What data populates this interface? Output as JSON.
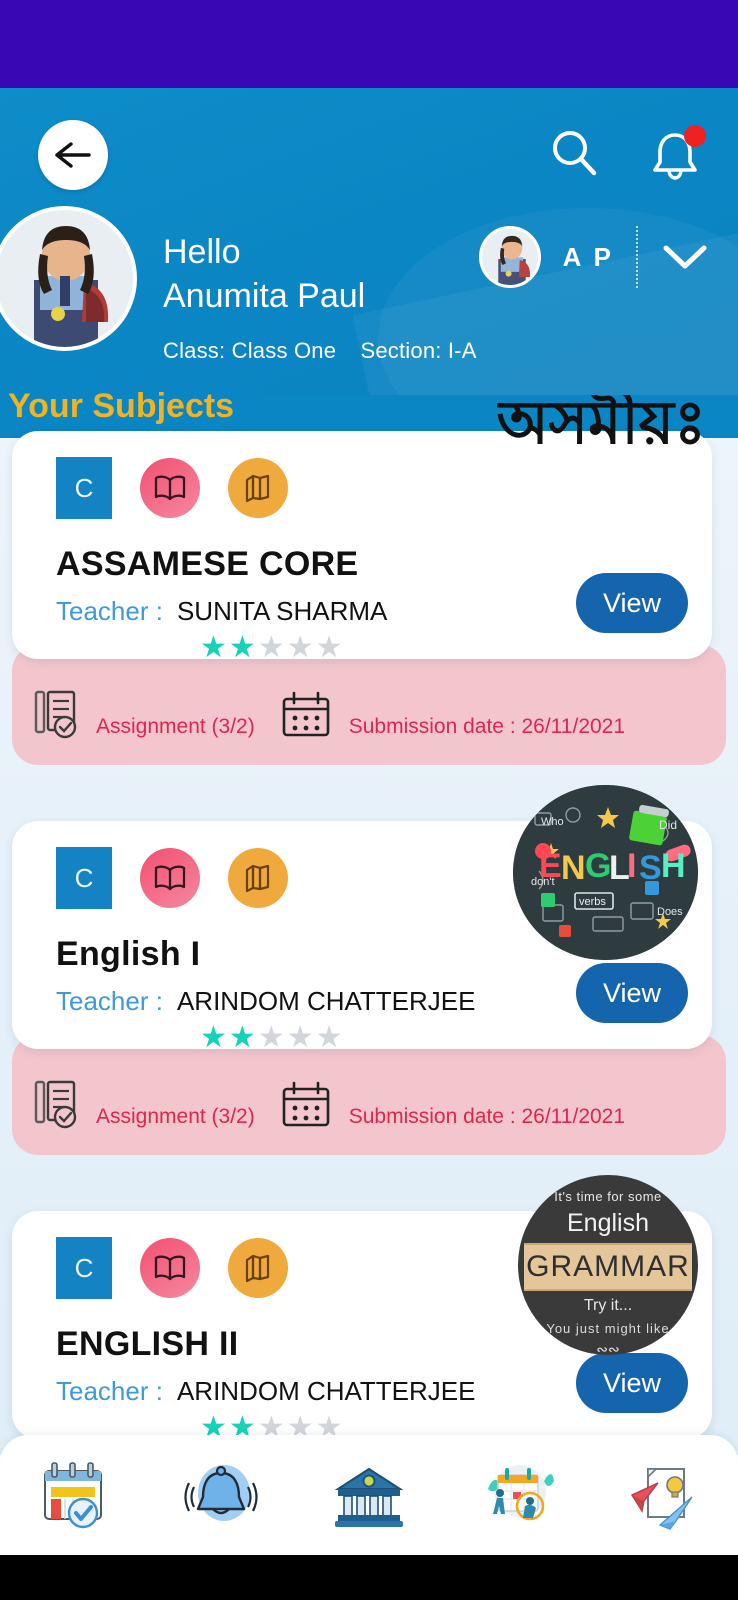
{
  "statusbar": {
    "color": "#3a07b5"
  },
  "header": {
    "bg_color": "#0b86c4",
    "back_icon": "arrow-left-icon",
    "search_icon": "search-icon",
    "notification_icon": "bell-icon",
    "notification_badge": true,
    "greeting": "Hello",
    "student_name": "Anumita Paul",
    "class_label": "Class: Class One",
    "section_label": "Section: I-A",
    "switcher_initials": "A P",
    "switcher_chevron": "chevron-down-icon"
  },
  "section_title": "Your Subjects",
  "accent": {
    "title_color": "#f0b323",
    "star_on": "#16d3b8",
    "star_off": "#d2d6db",
    "view_button": "#1464ae",
    "teacher_label": "#3f9ad6",
    "assignment_text": "#e0254e",
    "assignment_bg": "#f3c6ce"
  },
  "labels": {
    "teacher": "Teacher :",
    "view": "View",
    "assignment_icon": "assignment-icon",
    "calendar_icon": "calendar-icon",
    "grade_badge": "C",
    "open_book_icon": "open-book-icon",
    "books_icon": "stacked-books-icon"
  },
  "subjects": [
    {
      "name": "ASSAMESE CORE",
      "teacher": "SUNITA SHARMA",
      "grade": "C",
      "rating": 2,
      "rating_max": 5,
      "assignment": "Assignment (3/2)",
      "submission": "Submission date : 26/11/2021",
      "badge_type": "assamese-script",
      "badge_text": "অসমীয়ঃ"
    },
    {
      "name": "English I",
      "teacher": "ARINDOM CHATTERJEE",
      "grade": "C",
      "rating": 2,
      "rating_max": 5,
      "assignment": "Assignment (3/2)",
      "submission": "Submission date : 26/11/2021",
      "badge_type": "english-doodle",
      "badge_text": "ENGLISH"
    },
    {
      "name": "ENGLISH II",
      "teacher": "ARINDOM CHATTERJEE",
      "grade": "C",
      "rating": 2,
      "rating_max": 5,
      "assignment": "",
      "submission": "",
      "badge_type": "grammar",
      "badge_top": "It's time for some",
      "badge_sub": "English",
      "badge_main": "GRAMMAR",
      "badge_try": "Try it...",
      "badge_like": "You just might like"
    }
  ],
  "bottom_nav": [
    {
      "icon": "calendar-check-icon",
      "label": ""
    },
    {
      "icon": "bell-ring-icon",
      "label": ""
    },
    {
      "icon": "institution-icon",
      "label": ""
    },
    {
      "icon": "schedule-people-icon",
      "label": ""
    },
    {
      "icon": "paper-plane-idea-icon",
      "label": ""
    }
  ]
}
